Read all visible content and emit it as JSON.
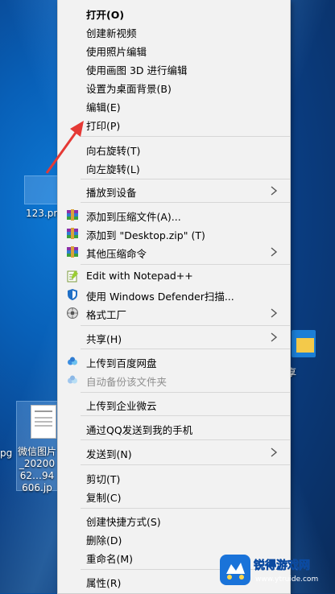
{
  "desktop": {
    "icon_123_label": "123.pn",
    "icon_wechat_label": "微信图片_2020062…94606.jp",
    "left_partial_label": "pg",
    "right_partial_label": "享"
  },
  "menu": {
    "items": [
      {
        "label": "打开(O)"
      },
      {
        "label": "创建新视频"
      },
      {
        "label": "使用照片编辑"
      },
      {
        "label": "使用画图 3D 进行编辑"
      },
      {
        "label": "设置为桌面背景(B)"
      },
      {
        "label": "编辑(E)"
      },
      {
        "label": "打印(P)"
      },
      {
        "label": "向右旋转(T)"
      },
      {
        "label": "向左旋转(L)"
      },
      {
        "label": "播放到设备"
      },
      {
        "label": "添加到压缩文件(A)..."
      },
      {
        "label": "添加到 \"Desktop.zip\" (T)"
      },
      {
        "label": "其他压缩命令"
      },
      {
        "label": "Edit with Notepad++"
      },
      {
        "label": "使用 Windows Defender扫描..."
      },
      {
        "label": "格式工厂"
      },
      {
        "label": "共享(H)"
      },
      {
        "label": "上传到百度网盘"
      },
      {
        "label": "自动备份该文件夹"
      },
      {
        "label": "上传到企业微云"
      },
      {
        "label": "通过QQ发送到我的手机"
      },
      {
        "label": "发送到(N)"
      },
      {
        "label": "剪切(T)"
      },
      {
        "label": "复制(C)"
      },
      {
        "label": "创建快捷方式(S)"
      },
      {
        "label": "删除(D)"
      },
      {
        "label": "重命名(M)"
      },
      {
        "label": "属性(R)"
      }
    ]
  },
  "watermark": {
    "title": "锐得游戏网",
    "url": "www.ytruide.com"
  },
  "colors": {
    "menu_bg": "#f2f2f2",
    "annotation_arrow": "#e53935",
    "desktop_blue": "#0860b8"
  }
}
